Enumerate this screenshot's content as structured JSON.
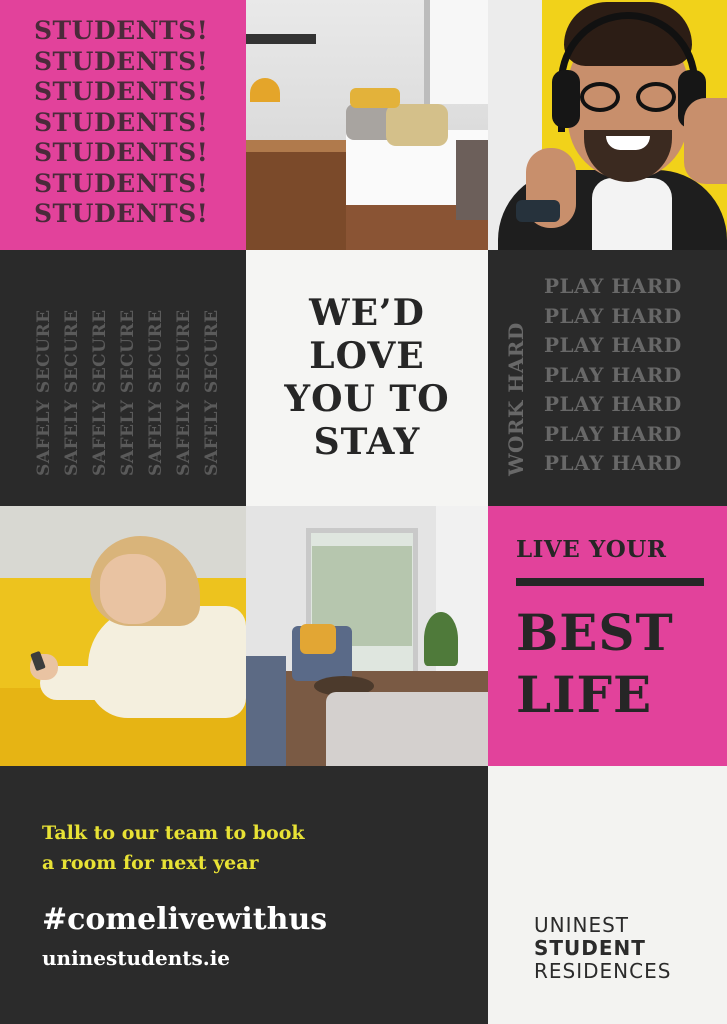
{
  "students": {
    "lines": [
      "STUDENTS!",
      "STUDENTS!",
      "STUDENTS!",
      "STUDENTS!",
      "STUDENTS!",
      "STUDENTS!",
      "STUDENTS!"
    ]
  },
  "safely_secure": {
    "columns": [
      "SAFELY SECURE",
      "SAFELY SECURE",
      "SAFELY SECURE",
      "SAFELY SECURE",
      "SAFELY SECURE",
      "SAFELY SECURE",
      "SAFELY SECURE"
    ]
  },
  "headline": {
    "lines": [
      "WE’D",
      "LOVE",
      "YOU TO",
      "STAY"
    ]
  },
  "work_play": {
    "side_label": "WORK HARD",
    "lines": [
      "PLAY HARD",
      "PLAY HARD",
      "PLAY HARD",
      "PLAY HARD",
      "PLAY HARD",
      "PLAY HARD",
      "PLAY HARD"
    ]
  },
  "best_life": {
    "top": "LIVE YOUR",
    "big1": "BEST",
    "big2": "LIFE"
  },
  "contact": {
    "talk_line1": "Talk to our team to book",
    "talk_line2": "a room for next year",
    "hashtag": "#comelivewithus",
    "url": "uninestudents.ie"
  },
  "logo": {
    "line1": "UNINEST",
    "line2": "STUDENT",
    "line3": "RESIDENCES"
  },
  "colors": {
    "magenta": "#e2429b",
    "dark": "#2a2a2a",
    "yellow_text": "#e8e235",
    "yellow_photo": "#f1d21a"
  }
}
